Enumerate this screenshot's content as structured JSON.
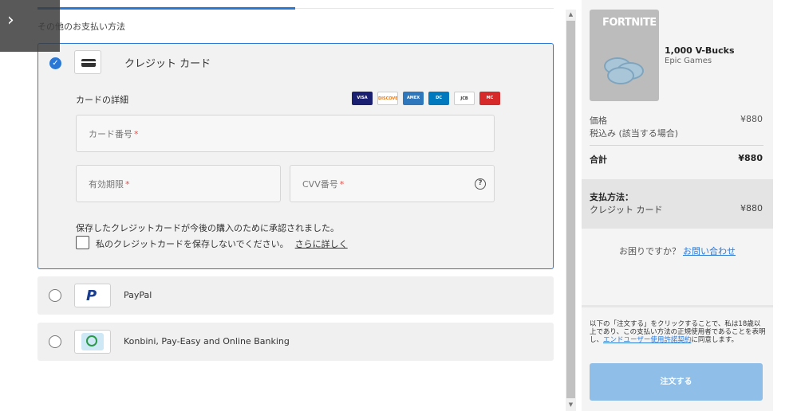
{
  "checkout": {
    "section_title": "その他のお支払い方法",
    "credit_card": {
      "title": "クレジット カード",
      "details_label": "カードの詳細",
      "brands": [
        {
          "name": "VISA",
          "color": "#1a1f71"
        },
        {
          "name": "DISCOVER",
          "color": "#ffffff"
        },
        {
          "name": "AMEX",
          "color": "#2e77bc"
        },
        {
          "name": "DINERS",
          "color": "#0079be"
        },
        {
          "name": "JCB",
          "color": "#ffffff"
        },
        {
          "name": "MasterCard",
          "color": "#d62a2a"
        }
      ],
      "card_number_placeholder": "カード番号",
      "expiry_placeholder": "有効期限",
      "cvv_placeholder": "CVV番号",
      "required_mark": "*",
      "help_glyph": "?",
      "saved_note": "保存したクレジットカードが今後の購入のために承認されました。",
      "dont_save_label": "私のクレジットカードを保存しないでください。",
      "learn_more": "さらに詳しく"
    },
    "other_methods": [
      {
        "label": "PayPal",
        "icon": "paypal-icon"
      },
      {
        "label": "Konbini, Pay-Easy and Online Banking",
        "icon": "payeasy-icon"
      }
    ]
  },
  "summary": {
    "thumb_logo": "FORTNITE",
    "product_name": "1,000 V-Bucks",
    "publisher": "Epic Games",
    "price_label": "価格",
    "price_value": "¥880",
    "tax_note": "税込み (該当する場合)",
    "total_label": "合計",
    "total_value": "¥880",
    "payment_heading": "支払方法：",
    "payment_method": "クレジット カード",
    "payment_amount": "¥880",
    "help_question": "お困りですか？",
    "help_link": "お問い合わせ",
    "terms_prefix": "以下の「注文する」をクリックすることで、私は18歳以上であり、この支払い方法の正規使用者であることを表明し、",
    "terms_link": "エンドユーザー使用許諾契約",
    "terms_suffix": "に同意します。",
    "order_button": "注文する"
  },
  "colors": {
    "accent": "#2a78d6",
    "order_button": "#8fbfe9"
  }
}
